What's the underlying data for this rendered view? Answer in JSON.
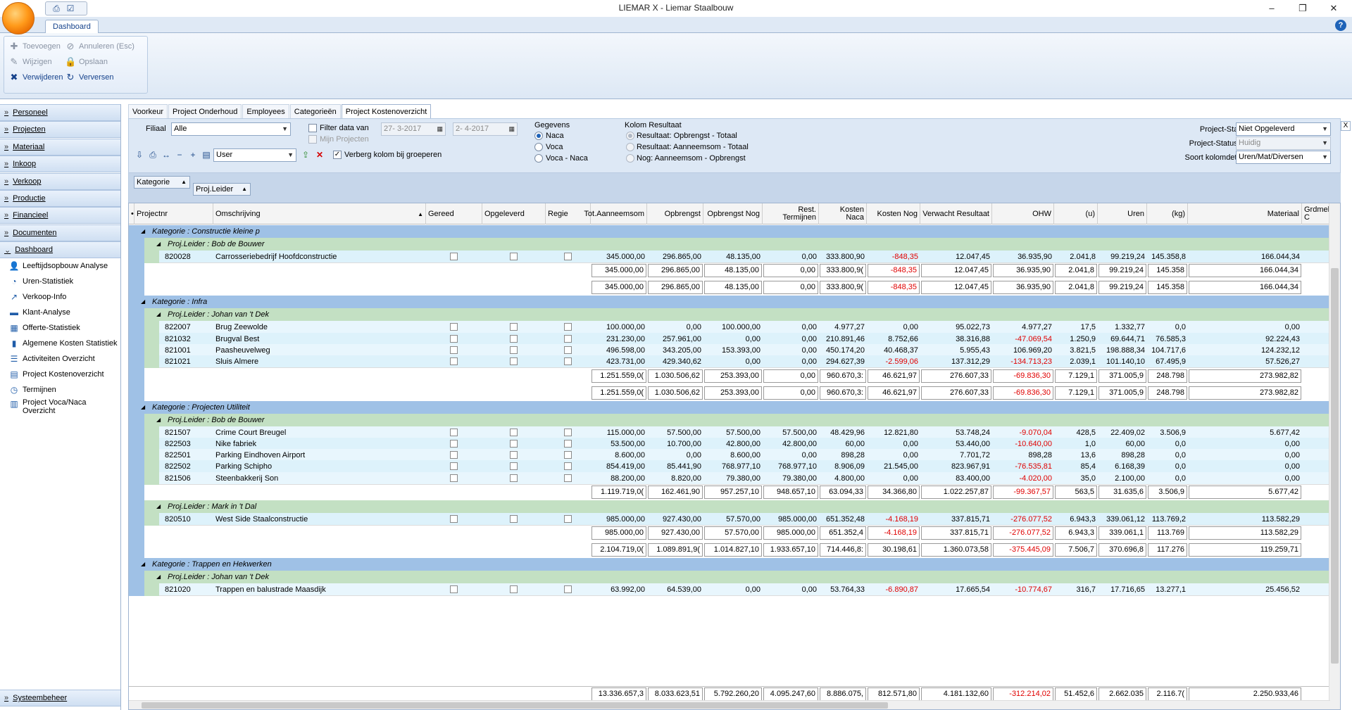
{
  "window": {
    "title": "LIEMAR X - Liemar Staalbouw",
    "min": "–",
    "max": "❐",
    "close": "✕"
  },
  "ribbon": {
    "tab": "Dashboard",
    "help": "?",
    "buttons": [
      {
        "label": "Toevoegen",
        "icon": "plus-icon",
        "enabled": false
      },
      {
        "label": "Annuleren (Esc)",
        "icon": "cancel-icon",
        "enabled": false
      },
      {
        "label": "Wijzigen",
        "icon": "pencil-icon",
        "enabled": false
      },
      {
        "label": "Opslaan",
        "icon": "save-icon",
        "enabled": false
      },
      {
        "label": "Verwijderen",
        "icon": "delete-icon",
        "enabled": true
      },
      {
        "label": "Verversen",
        "icon": "refresh-icon",
        "enabled": true
      }
    ]
  },
  "nav": {
    "sections": [
      "Personeel",
      "Projecten",
      "Materiaal",
      "Inkoop",
      "Verkoop",
      "Productie",
      "Financieel",
      "Documenten",
      "Dashboard"
    ],
    "items": [
      "Leeftijdsopbouw Analyse",
      "Uren-Statistiek",
      "Verkoop-Info",
      "Klant-Analyse",
      "Offerte-Statistiek",
      "Algemene Kosten Statistiek",
      "Activiteiten Overzicht",
      "Project Kostenoverzicht",
      "Termijnen",
      "Project Voca/Naca Overzicht"
    ],
    "footer": "Systeembeheer"
  },
  "tabs": [
    "Voorkeur",
    "Project Onderhoud",
    "Employees",
    "Categorieën",
    "Project Kostenoverzicht"
  ],
  "filters": {
    "filiaal_label": "Filiaal",
    "filiaal_value": "Alle",
    "filter_data_label": "Filter data van",
    "date_from": "27- 3-2017",
    "date_to": "2- 4-2017",
    "mijn_projecten": "Mijn Projecten",
    "user_value": "User",
    "verberg_label": "Verberg kolom bij groeperen",
    "gegevens_label": "Gegevens",
    "gegevens_opts": [
      "Naca",
      "Voca",
      "Voca - Naca"
    ],
    "kolom_label": "Kolom Resultaat",
    "kolom_opts": [
      "Resultaat: Opbrengst - Totaal",
      "Resultaat: Aanneemsom - Totaal",
      "Nog: Aanneemsom - Opbrengst"
    ],
    "status_label": "Project-Status",
    "status_value": "Niet Opgeleverd",
    "status_op_label": "Project-Status op",
    "status_op_value": "Huidig",
    "soort_label": "Soort kolomdetails",
    "soort_value": "Uren/Mat/Diversen"
  },
  "group_chips": [
    "Kategorie",
    "Proj.Leider"
  ],
  "columns": [
    "Projectnr",
    "Omschrijving",
    "Gereed",
    "Opgeleverd",
    "Regie",
    "Tot.Aanneemsom",
    "Opbrengst",
    "Opbrengst Nog",
    "Rest. Termijnen",
    "Kosten Naca",
    "Kosten Nog",
    "Verwacht Resultaat",
    "OHW",
    "(u)",
    "Uren",
    "(kg)",
    "Materiaal",
    "Grdmeld C"
  ],
  "grid": [
    {
      "t": "g1",
      "text": "Kategorie : Constructie kleine p"
    },
    {
      "t": "g2",
      "text": "Proj.Leider : Bob de Bouwer"
    },
    {
      "t": "d",
      "v": [
        "820028",
        "Carrosseriebedrijf Hoofdconstructie",
        "345.000,00",
        "296.865,00",
        "48.135,00",
        "0,00",
        "333.800,90",
        "-848,35",
        "12.047,45",
        "36.935,90",
        "2.041,8",
        "99.219,24",
        "145.358,8",
        "166.044,34"
      ]
    },
    {
      "t": "s",
      "v": [
        "345.000,00",
        "296.865,00",
        "48.135,00",
        "0,00",
        "333.800,9(",
        "-848,35",
        "12.047,45",
        "36.935,90",
        "2.041,8",
        "99.219,24",
        "145.358",
        "166.044,34"
      ]
    },
    {
      "t": "s",
      "v": [
        "345.000,00",
        "296.865,00",
        "48.135,00",
        "0,00",
        "333.800,9(",
        "-848,35",
        "12.047,45",
        "36.935,90",
        "2.041,8",
        "99.219,24",
        "145.358",
        "166.044,34"
      ]
    },
    {
      "t": "g1",
      "text": "Kategorie : Infra"
    },
    {
      "t": "g2",
      "text": "Proj.Leider : Johan van 't Dek"
    },
    {
      "t": "d",
      "v": [
        "822007",
        "Brug Zeewolde",
        "100.000,00",
        "0,00",
        "100.000,00",
        "0,00",
        "4.977,27",
        "0,00",
        "95.022,73",
        "4.977,27",
        "17,5",
        "1.332,77",
        "0,0",
        "0,00"
      ]
    },
    {
      "t": "d",
      "v": [
        "821032",
        "Brugval Best",
        "231.230,00",
        "257.961,00",
        "0,00",
        "0,00",
        "210.891,46",
        "8.752,66",
        "38.316,88",
        "-47.069,54",
        "1.250,9",
        "69.644,71",
        "76.585,3",
        "92.224,43"
      ]
    },
    {
      "t": "d",
      "v": [
        "821001",
        "Paasheuvelweg",
        "496.598,00",
        "343.205,00",
        "153.393,00",
        "0,00",
        "450.174,20",
        "40.468,37",
        "5.955,43",
        "106.969,20",
        "3.821,5",
        "198.888,34",
        "104.717,6",
        "124.232,12"
      ]
    },
    {
      "t": "d",
      "v": [
        "821021",
        "Sluis Almere",
        "423.731,00",
        "429.340,62",
        "0,00",
        "0,00",
        "294.627,39",
        "-2.599,06",
        "137.312,29",
        "-134.713,23",
        "2.039,1",
        "101.140,10",
        "67.495,9",
        "57.526,27"
      ]
    },
    {
      "t": "s",
      "v": [
        "1.251.559,0(",
        "1.030.506,62",
        "253.393,00",
        "0,00",
        "960.670,3:",
        "46.621,97",
        "276.607,33",
        "-69.836,30",
        "7.129,1",
        "371.005,9",
        "248.798",
        "273.982,82"
      ]
    },
    {
      "t": "s",
      "v": [
        "1.251.559,0(",
        "1.030.506,62",
        "253.393,00",
        "0,00",
        "960.670,3:",
        "46.621,97",
        "276.607,33",
        "-69.836,30",
        "7.129,1",
        "371.005,9",
        "248.798",
        "273.982,82"
      ]
    },
    {
      "t": "g1",
      "text": "Kategorie : Projecten Utiliteit"
    },
    {
      "t": "g2",
      "text": "Proj.Leider : Bob de Bouwer"
    },
    {
      "t": "d",
      "v": [
        "821507",
        "Crime Court Breugel",
        "115.000,00",
        "57.500,00",
        "57.500,00",
        "57.500,00",
        "48.429,96",
        "12.821,80",
        "53.748,24",
        "-9.070,04",
        "428,5",
        "22.409,02",
        "3.506,9",
        "5.677,42"
      ]
    },
    {
      "t": "d",
      "v": [
        "822503",
        "Nike fabriek",
        "53.500,00",
        "10.700,00",
        "42.800,00",
        "42.800,00",
        "60,00",
        "0,00",
        "53.440,00",
        "-10.640,00",
        "1,0",
        "60,00",
        "0,0",
        "0,00"
      ]
    },
    {
      "t": "d",
      "v": [
        "822501",
        "Parking Eindhoven Airport",
        "8.600,00",
        "0,00",
        "8.600,00",
        "0,00",
        "898,28",
        "0,00",
        "7.701,72",
        "898,28",
        "13,6",
        "898,28",
        "0,0",
        "0,00"
      ]
    },
    {
      "t": "d",
      "v": [
        "822502",
        "Parking Schipho",
        "854.419,00",
        "85.441,90",
        "768.977,10",
        "768.977,10",
        "8.906,09",
        "21.545,00",
        "823.967,91",
        "-76.535,81",
        "85,4",
        "6.168,39",
        "0,0",
        "0,00"
      ]
    },
    {
      "t": "d",
      "v": [
        "821506",
        "Steenbakkerij Son",
        "88.200,00",
        "8.820,00",
        "79.380,00",
        "79.380,00",
        "4.800,00",
        "0,00",
        "83.400,00",
        "-4.020,00",
        "35,0",
        "2.100,00",
        "0,0",
        "0,00"
      ]
    },
    {
      "t": "s",
      "v": [
        "1.119.719,0(",
        "162.461,90",
        "957.257,10",
        "948.657,10",
        "63.094,33",
        "34.366,80",
        "1.022.257,87",
        "-99.367,57",
        "563,5",
        "31.635,6",
        "3.506,9",
        "5.677,42"
      ]
    },
    {
      "t": "g2",
      "text": "Proj.Leider : Mark in 't Dal"
    },
    {
      "t": "d",
      "v": [
        "820510",
        "West Side Staalconstructie",
        "985.000,00",
        "927.430,00",
        "57.570,00",
        "985.000,00",
        "651.352,48",
        "-4.168,19",
        "337.815,71",
        "-276.077,52",
        "6.943,3",
        "339.061,12",
        "113.769,2",
        "113.582,29"
      ]
    },
    {
      "t": "s",
      "v": [
        "985.000,00",
        "927.430,00",
        "57.570,00",
        "985.000,00",
        "651.352,4",
        "-4.168,19",
        "337.815,71",
        "-276.077,52",
        "6.943,3",
        "339.061,1",
        "113.769",
        "113.582,29"
      ]
    },
    {
      "t": "s",
      "v": [
        "2.104.719,0(",
        "1.089.891,9(",
        "1.014.827,10",
        "1.933.657,10",
        "714.446,8:",
        "30.198,61",
        "1.360.073,58",
        "-375.445,09",
        "7.506,7",
        "370.696,8",
        "117.276",
        "119.259,71"
      ]
    },
    {
      "t": "g1",
      "text": "Kategorie : Trappen en Hekwerken"
    },
    {
      "t": "g2",
      "text": "Proj.Leider : Johan van 't Dek"
    },
    {
      "t": "d",
      "v": [
        "821020",
        "Trappen en balustrade Maasdijk",
        "63.992,00",
        "64.539,00",
        "0,00",
        "0,00",
        "53.764,33",
        "-6.890,87",
        "17.665,54",
        "-10.774,67",
        "316,7",
        "17.716,65",
        "13.277,1",
        "25.456,52"
      ]
    }
  ],
  "totals": [
    "13.336.657,3",
    "8.033.623,51",
    "5.792.260,20",
    "4.095.247,60",
    "8.886.075,",
    "812.571,80",
    "4.181.132,60",
    "-312.214,02",
    "51.452,6",
    "2.662.035",
    "2.116.7(",
    "2.250.933,46"
  ]
}
